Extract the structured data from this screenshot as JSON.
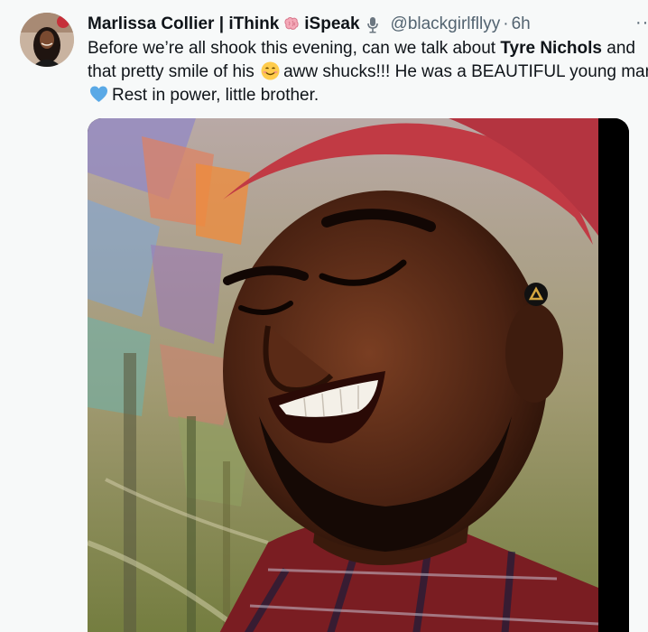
{
  "tweet": {
    "author": {
      "display_name": "Marlissa Collier | iThink",
      "name_suffix": "iSpeak",
      "handle": "@blackgirlfllyy",
      "separator": "·",
      "time": "6h",
      "avatar_icon": "profile-photo"
    },
    "more_label": "··",
    "text": {
      "line1_start": "Before we’re all shook this evening, can we talk about ",
      "line1_bold": "Tyre Nichols",
      "line1_end": " and",
      "line2_start": "that pretty smile of his",
      "line2_end": "aww shucks!!! He was a BEAUTIFUL young man",
      "line3": "Rest in power, little brother."
    },
    "emojis": {
      "brain": "brain-emoji",
      "microphone": "microphone-emoji",
      "smile": "smiling-face-emoji",
      "heart": "blue-heart-emoji"
    },
    "media": {
      "description_icon": "photo-of-smiling-man"
    }
  },
  "colors": {
    "text": "#0f1419",
    "secondary": "#536471",
    "background": "#f7f9f9",
    "heart": "#5aa9e6"
  }
}
